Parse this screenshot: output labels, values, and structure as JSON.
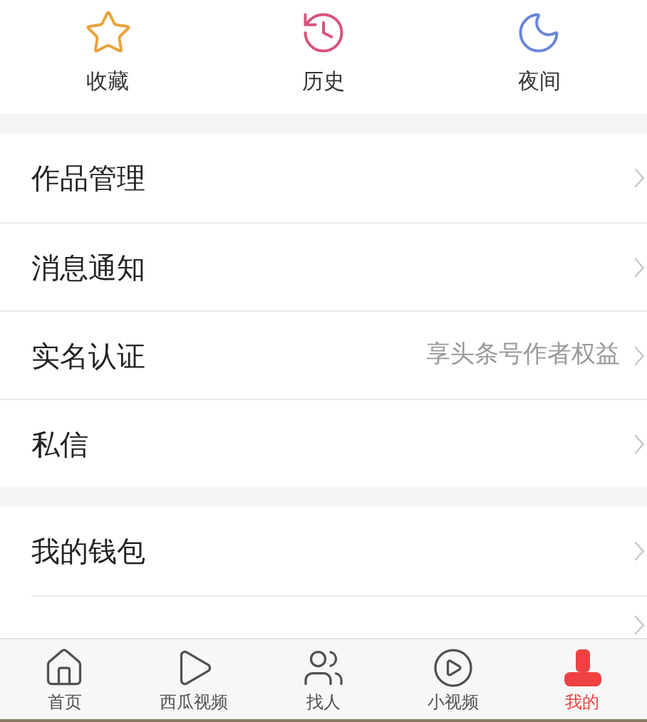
{
  "shortcuts": [
    {
      "label": "收藏",
      "color": "#e9a23b"
    },
    {
      "label": "历史",
      "color": "#d9547a"
    },
    {
      "label": "夜间",
      "color": "#6a86d8"
    }
  ],
  "menu_groups": [
    [
      {
        "label": "作品管理"
      },
      {
        "label": "消息通知"
      },
      {
        "label": "实名认证",
        "hint": "享头条号作者权益"
      },
      {
        "label": "私信"
      }
    ],
    [
      {
        "label": "我的钱包"
      }
    ]
  ],
  "tab_bar": [
    {
      "label": "首页",
      "selected": false
    },
    {
      "label": "西瓜视频",
      "selected": false
    },
    {
      "label": "找人",
      "selected": false
    },
    {
      "label": "小视频",
      "selected": false
    },
    {
      "label": "我的",
      "selected": true
    }
  ]
}
